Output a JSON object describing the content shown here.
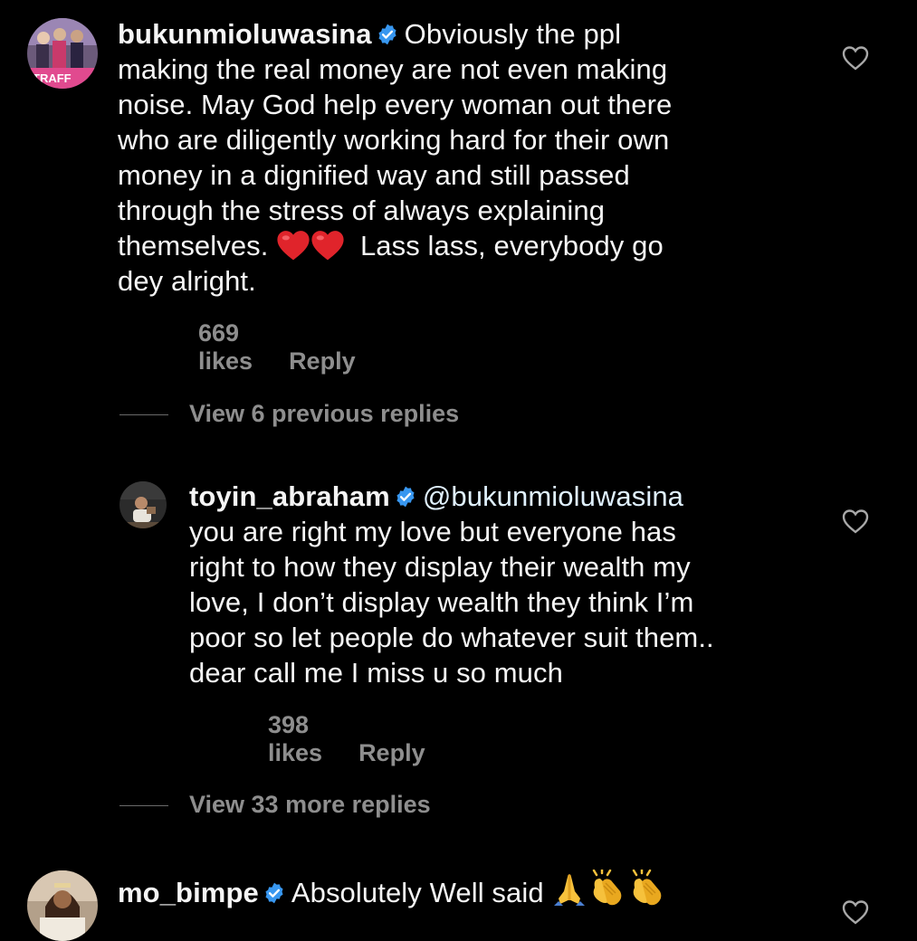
{
  "comments": [
    {
      "username": "bukunmioluwasina",
      "text_lines": [
        "Obviously the ppl",
        "making the real money are not even making",
        "noise. May God help every woman out there",
        "who are diligently working hard for their own",
        "money in a dignified way and still passed",
        "through the stress of always explaining",
        "themselves.",
        "Lass lass, everybody go",
        "dey alright."
      ],
      "emoji": [
        "red-heart",
        "red-heart"
      ],
      "likes": "669 likes",
      "reply": "Reply",
      "avatar_text": "TRAFF"
    },
    {
      "username": "toyin_abraham",
      "mention": "@bukunmioluwasina",
      "text_lines": [
        "you are right my love but everyone has",
        "right to how they display their wealth my",
        "love, I don’t display wealth they think I’m",
        "poor so let people do whatever suit them..",
        "dear call me I miss u so much"
      ],
      "likes": "398 likes",
      "reply": "Reply"
    },
    {
      "username": "mo_bimpe",
      "text": "Absolutely Well said",
      "emoji": [
        "folded-hands",
        "clapping-hands",
        "clapping-hands"
      ]
    }
  ],
  "threads": {
    "previous": "View 6 previous replies",
    "more": "View 33 more replies"
  },
  "colors": {
    "background": "#000000",
    "text": "#f5f5f5",
    "muted": "#8e8e8e",
    "verified": "#3897f0"
  }
}
